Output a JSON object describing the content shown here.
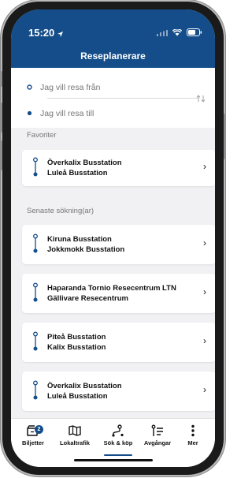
{
  "status_bar": {
    "time": "15:20"
  },
  "header": {
    "title": "Reseplanerare"
  },
  "search": {
    "from_placeholder": "Jag vill resa från",
    "to_placeholder": "Jag vill resa till"
  },
  "favorites": {
    "label": "Favoriter",
    "items": [
      {
        "from": "Överkalix Busstation",
        "to": "Luleå Busstation"
      }
    ]
  },
  "recent": {
    "label": "Senaste sökning(ar)",
    "items": [
      {
        "from": "Kiruna Busstation",
        "to": "Jokkmokk Busstation"
      },
      {
        "from": "Haparanda Tornio Resecentrum LTN",
        "to": "Gällivare Resecentrum"
      },
      {
        "from": "Piteå Busstation",
        "to": "Kalix Busstation"
      },
      {
        "from": "Överkalix Busstation",
        "to": "Luleå Busstation"
      }
    ]
  },
  "tabbar": {
    "badge": "2",
    "tabs": [
      {
        "label": "Biljetter",
        "icon": "ticket-icon"
      },
      {
        "label": "Lokaltrafik",
        "icon": "map-icon"
      },
      {
        "label": "Sök & köp",
        "icon": "route-search-icon",
        "active": true
      },
      {
        "label": "Avgångar",
        "icon": "departures-icon"
      },
      {
        "label": "Mer",
        "icon": "more-icon"
      }
    ]
  },
  "colors": {
    "brand": "#144d8a",
    "background": "#f1f1f3",
    "card": "#ffffff"
  }
}
